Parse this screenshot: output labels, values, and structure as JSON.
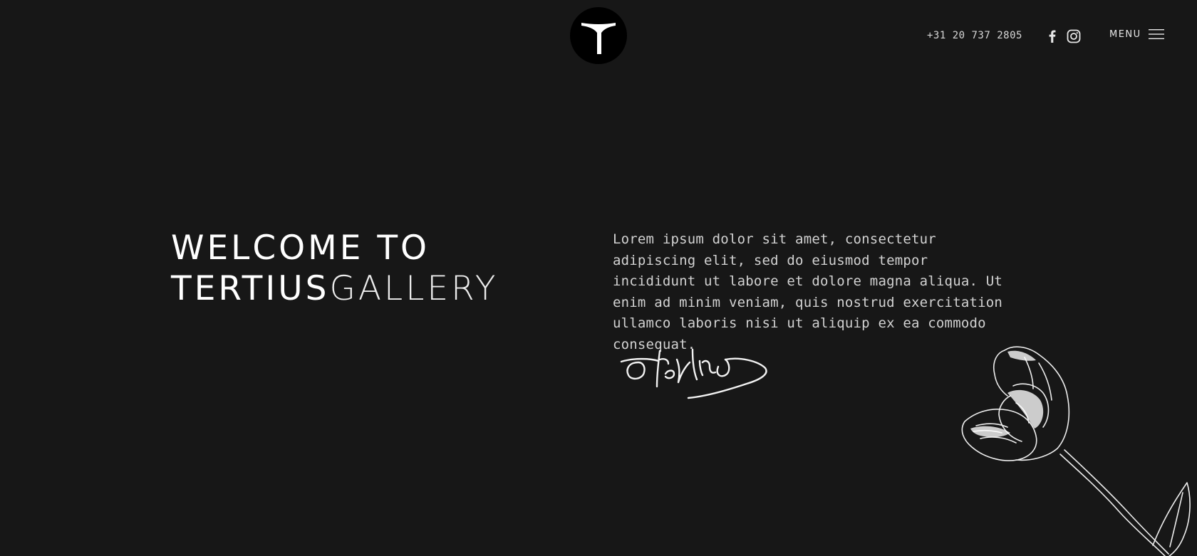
{
  "header": {
    "logo_letter": "T",
    "phone": "+31 20 737 2805",
    "social": [
      {
        "name": "facebook-icon"
      },
      {
        "name": "instagram-icon"
      }
    ],
    "menu_label": "MENU"
  },
  "hero": {
    "headline_line1": "WELCOME TO",
    "headline_strong": "TERTIUS",
    "headline_thin": "GALLERY",
    "intro": "Lorem ipsum dolor sit amet, consectetur adipiscing elit, sed do eiusmod tempor incididunt ut labore et dolore magna aliqua. Ut enim ad minim veniam, quis nostrud exercitation ullamco laboris nisi ut aliquip ex ea commodo consequat."
  },
  "colors": {
    "background": "#171717",
    "text": "#ffffff",
    "logo_bg": "#000000"
  }
}
